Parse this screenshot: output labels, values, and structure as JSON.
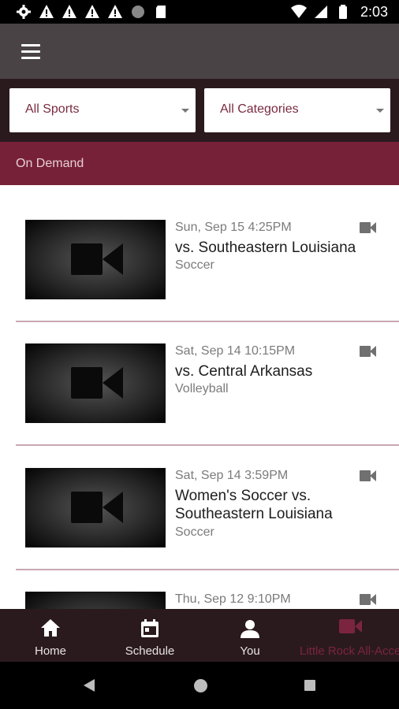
{
  "status_bar": {
    "time": "2:03",
    "icons": [
      "gear-icon",
      "warning-icon",
      "warning-icon",
      "warning-icon",
      "warning-icon",
      "circle-icon",
      "sd-card-icon",
      "wifi-icon",
      "cell-signal-icon",
      "battery-icon"
    ]
  },
  "app_bar": {
    "menu_icon": "hamburger-menu-icon"
  },
  "filters": {
    "sports": "All Sports",
    "categories": "All Categories"
  },
  "section": {
    "title": "On Demand"
  },
  "items": [
    {
      "date": "Sun, Sep 15 4:25PM",
      "title": "vs. Southeastern Louisiana",
      "sport": "Soccer"
    },
    {
      "date": "Sat, Sep 14 10:15PM",
      "title": "vs. Central Arkansas",
      "sport": "Volleyball"
    },
    {
      "date": "Sat, Sep 14 3:59PM",
      "title": "Women's Soccer vs. Southeastern Louisiana",
      "sport": "Soccer"
    },
    {
      "date": "Thu, Sep 12 9:10PM",
      "title": "",
      "sport": ""
    }
  ],
  "bottom_nav": {
    "home": "Home",
    "schedule": "Schedule",
    "you": "You",
    "all_access": "Little Rock All-Access"
  },
  "colors": {
    "app_bar": "#4a4345",
    "filter_bar": "#2a1a1e",
    "section_header": "#772139",
    "accent": "#7b2440"
  }
}
